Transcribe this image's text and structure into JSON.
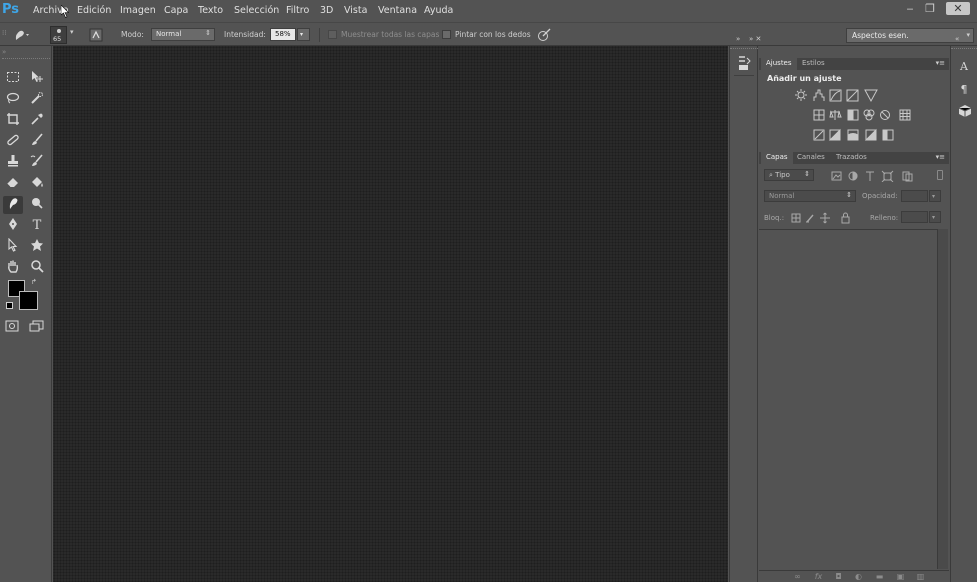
{
  "app": {
    "logo": "Ps"
  },
  "menu": {
    "items": [
      "Archivo",
      "Edición",
      "Imagen",
      "Capa",
      "Texto",
      "Selección",
      "Filtro",
      "3D",
      "Vista",
      "Ventana",
      "Ayuda"
    ]
  },
  "window_controls": {
    "minimize": "‒",
    "restore": "❐",
    "close": "✕"
  },
  "options": {
    "brush_size": "65",
    "mode_label": "Modo:",
    "mode_value": "Normal",
    "intensity_label": "Intensidad:",
    "intensity_value": "58%",
    "sample_all_label": "Muestrear todas las capas",
    "finger_paint_label": "Pintar con los dedos",
    "workspace_value": "Aspectos esen."
  },
  "colors": {
    "accent": "#3ea6e8",
    "foreground": "#000000",
    "background": "#000000",
    "canvas": "#2a2a2a"
  },
  "adjustments_panel": {
    "tabs": [
      "Ajustes",
      "Estilos"
    ],
    "title": "Añadir un ajuste"
  },
  "layers_panel": {
    "tabs": [
      "Capas",
      "Canales",
      "Trazados"
    ],
    "filter_label": "Tipo",
    "blend_value": "Normal",
    "opacity_label": "Opacidad:",
    "lock_label": "Bloq.:",
    "fill_label": "Relleno:"
  },
  "tools": [
    "marquee-tool",
    "move-tool",
    "lasso-tool",
    "quick-selection-tool",
    "crop-tool",
    "eyedropper-tool",
    "spot-healing-tool",
    "brush-tool",
    "clone-stamp-tool",
    "history-brush-tool",
    "eraser-tool",
    "paint-bucket-tool",
    "smudge-tool",
    "dodge-tool",
    "pen-tool",
    "type-tool",
    "path-selection-tool",
    "shape-tool",
    "hand-tool",
    "zoom-tool"
  ]
}
